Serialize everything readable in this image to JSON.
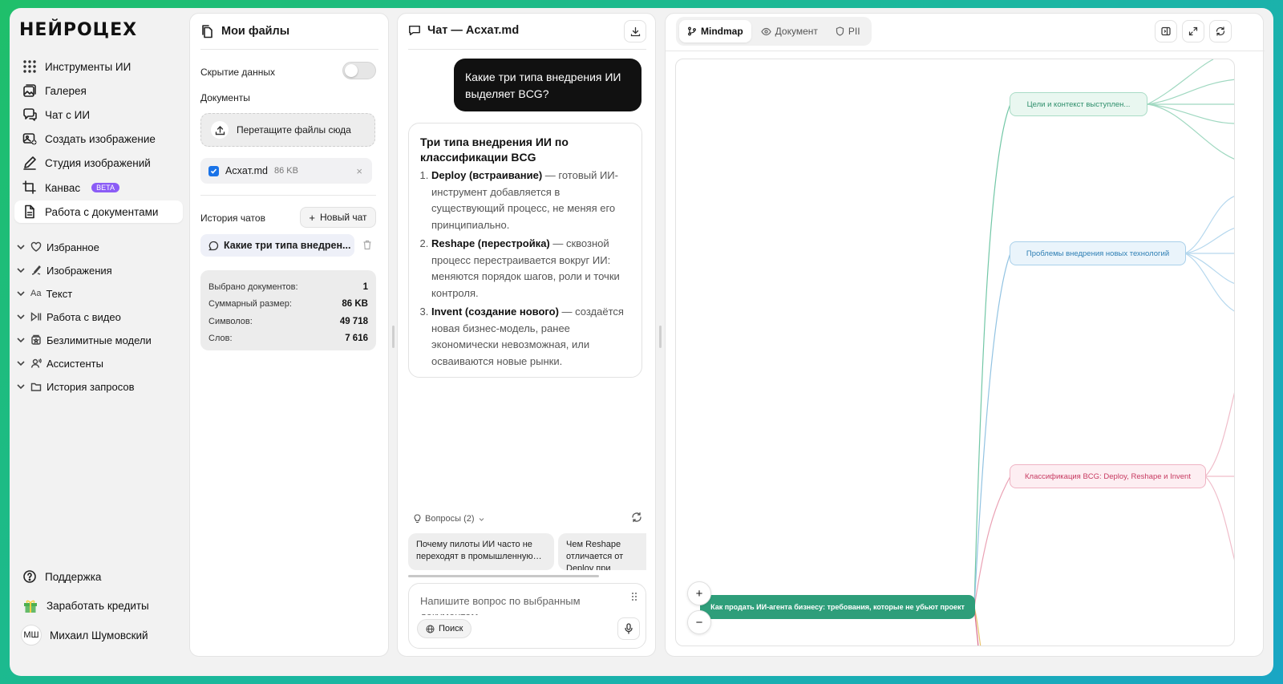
{
  "brand": {
    "logo_text": "НЕЙРОЦЕХ"
  },
  "nav": {
    "items": [
      {
        "label": "Инструменты ИИ",
        "icon": "grid-icon"
      },
      {
        "label": "Галерея",
        "icon": "gallery-icon"
      },
      {
        "label": "Чат с ИИ",
        "icon": "chat-icon"
      },
      {
        "label": "Создать изображение",
        "icon": "image-add-icon"
      },
      {
        "label": "Студия изображений",
        "icon": "pen-icon"
      },
      {
        "label": "Канвас",
        "icon": "crop-icon",
        "badge": "BETA"
      },
      {
        "label": "Работа с документами",
        "icon": "document-icon",
        "active": true
      }
    ],
    "groups": [
      {
        "label": "Избранное",
        "icon": "heart-icon"
      },
      {
        "label": "Изображения",
        "icon": "brush-icon"
      },
      {
        "label": "Текст",
        "icon": "text-icon",
        "icon_text": "Aa"
      },
      {
        "label": "Работа с видео",
        "icon": "video-icon"
      },
      {
        "label": "Безлимитные модели",
        "icon": "unlimited-icon"
      },
      {
        "label": "Ассистенты",
        "icon": "assistant-icon"
      },
      {
        "label": "История запросов",
        "icon": "folder-icon"
      }
    ],
    "support": "Поддержка",
    "earn": "Заработать кредиты",
    "user": {
      "initials": "МШ",
      "name": "Михаил Шумовский"
    }
  },
  "files": {
    "title": "Мои файлы",
    "hide_data_label": "Скрытие данных",
    "hide_data_on": false,
    "documents_label": "Документы",
    "dropzone": "Перетащите файлы сюда",
    "file": {
      "name": "Acxaт.md",
      "size": "86 KB",
      "checked": true
    },
    "history_label": "История чатов",
    "new_chat": "Новый чат",
    "history_item": "Какие три типа внедрен...",
    "stats": [
      {
        "label": "Выбрано документов:",
        "value": "1"
      },
      {
        "label": "Суммарный размер:",
        "value": "86 KB"
      },
      {
        "label": "Символов:",
        "value": "49 718"
      },
      {
        "label": "Слов:",
        "value": "7 616"
      }
    ]
  },
  "chat": {
    "title": "Чат — Acxaт.md",
    "user_message": "Какие три типа внедрения ИИ выделяет BCG?",
    "answer": {
      "heading": "Три типа внедрения ИИ по классификации BCG",
      "items": [
        {
          "bold": "Deploy (встраивание)",
          "text": " — готовый ИИ-инструмент добавляется в существующий процесс, не меняя его принципиально."
        },
        {
          "bold": "Reshape (перестройка)",
          "text": " — сквозной процесс перестраивается вокруг ИИ: меняются порядок шагов, роли и точки контроля."
        },
        {
          "bold": "Invent (создание нового)",
          "text": " — создаётся новая бизнес-модель, ранее экономически невозможная, или осваиваются новые рынки."
        }
      ]
    },
    "questions_label": "Вопросы (2)",
    "questions": [
      "Почему пилоты ИИ часто не переходят в промышленную…",
      "Чем Reshape отличается от Deploy при внедрении…"
    ],
    "input_placeholder": "Напишите вопрос по выбранным документам",
    "search_label": "Поиск"
  },
  "mindmap": {
    "tabs": [
      {
        "label": "Mindmap",
        "icon": "branch-icon",
        "active": true
      },
      {
        "label": "Документ",
        "icon": "eye-icon",
        "active": false
      },
      {
        "label": "PII",
        "icon": "shield-icon",
        "active": false
      }
    ],
    "root": "Как продать ИИ-агента бизнесу: требования, которые не убьют проект",
    "nodes": [
      {
        "label": "Цели и контекст выступлен...",
        "color": "#3aa57c"
      },
      {
        "label": "Проблемы внедрения новых технологий",
        "color": "#3b8fc4"
      },
      {
        "label": "Классификация BCG: Deploy, Reshape и Invent",
        "color": "#d6456a"
      }
    ],
    "root_color": "#2e9e7a",
    "zoom_in": "+",
    "zoom_out": "−"
  }
}
